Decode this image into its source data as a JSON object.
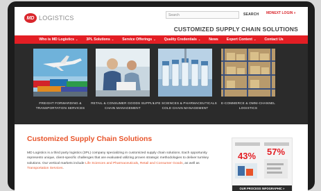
{
  "header": {
    "logo_mark": "MD",
    "logo_text": "LOGISTICS",
    "search_placeholder": "Search",
    "search_button": "SEARCH",
    "report_button": "MDNEXT LOGIN »",
    "tagline": "CUSTOMIZED SUPPLY CHAIN SOLUTIONS"
  },
  "nav": {
    "items": [
      {
        "label": "Who is MD Logistics",
        "has_dropdown": true
      },
      {
        "label": "3PL Solutions",
        "has_dropdown": true
      },
      {
        "label": "Service Offerings",
        "has_dropdown": true
      },
      {
        "label": "Quality Credentials",
        "has_dropdown": true
      },
      {
        "label": "News",
        "has_dropdown": false
      },
      {
        "label": "Expert Content",
        "has_dropdown": true
      },
      {
        "label": "Contact Us",
        "has_dropdown": false
      }
    ]
  },
  "tiles": [
    {
      "caption": "FREIGHT FORWARDING & TRANSPORTATION SERVICES",
      "icon": "airplane-cargo-image"
    },
    {
      "caption": "RETAIL & CONSUMER GOODS SUPPLY CHAIN MANAGEMENT",
      "icon": "business-people-image"
    },
    {
      "caption": "LIFE SCIENCES & PHARMACEUTICALS COLD CHAIN MANAGEMENT",
      "icon": "vials-image"
    },
    {
      "caption": "E-COMMERCE & OMNI-CHANNEL LOGISTICS",
      "icon": "warehouse-shelves-image"
    }
  ],
  "main": {
    "title": "Customized Supply Chain Solutions",
    "body_1": "MD Logistics is a third party logistics (3PL) company specializing in customized supply chain solutions. Each opportunity represents unique, client-specific challenges that are evaluated utilizing proven strategic methodologies to deliver turnkey solutions. Our vertical markets include ",
    "link_1": "Life Sciences and Pharmaceuticals",
    "sep_1": ", ",
    "link_2": "Retail and Consumer Goods",
    "sep_2": ", as well as ",
    "link_3": "Transportation Services",
    "end": "."
  },
  "infographic": {
    "stat_1": "43%",
    "stat_2": "57%",
    "button": "OUR PROCESS INFOGRAPHIC »"
  },
  "colors": {
    "brand_red": "#e31e24",
    "accent_orange": "#e8542a",
    "band_dark": "#2b2b2b"
  }
}
